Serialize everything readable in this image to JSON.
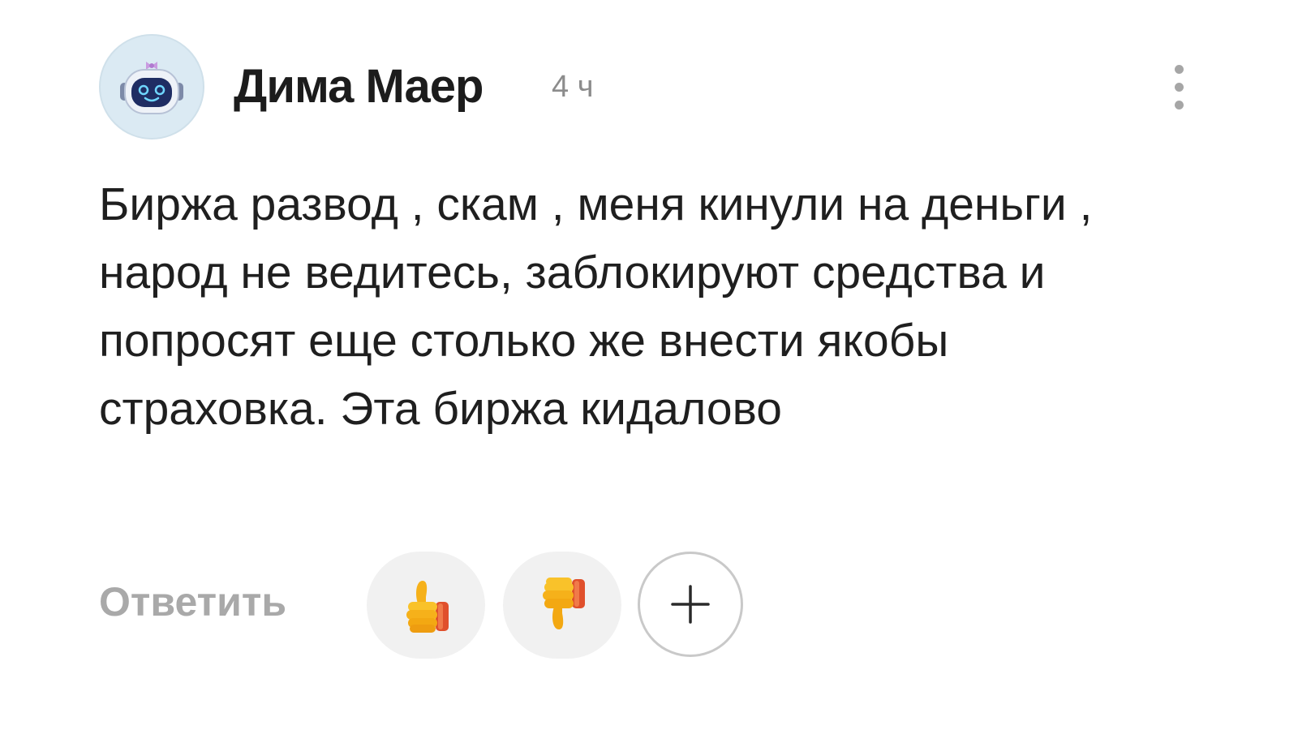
{
  "comment": {
    "author": "Дима Маер",
    "time": "4 ч",
    "text": "Биржа развод , скам , меня кинули на деньги , народ не ведитесь, заблокируют средства и попросят еще столько же внести якобы страховка. Эта биржа кидалово",
    "reply_label": "Ответить",
    "avatar_icon": "robot-avatar-icon",
    "reactions": [
      {
        "icon": "thumbs-up-icon"
      },
      {
        "icon": "thumbs-down-icon"
      }
    ],
    "add_reaction_icon": "plus-icon",
    "more_icon": "more-vertical-icon"
  },
  "colors": {
    "text": "#1f1f1f",
    "muted": "#a9a9a9",
    "time": "#8c8c8c",
    "reaction_bg": "#f1f1f1",
    "avatar_bg": "#dbeaf3"
  }
}
